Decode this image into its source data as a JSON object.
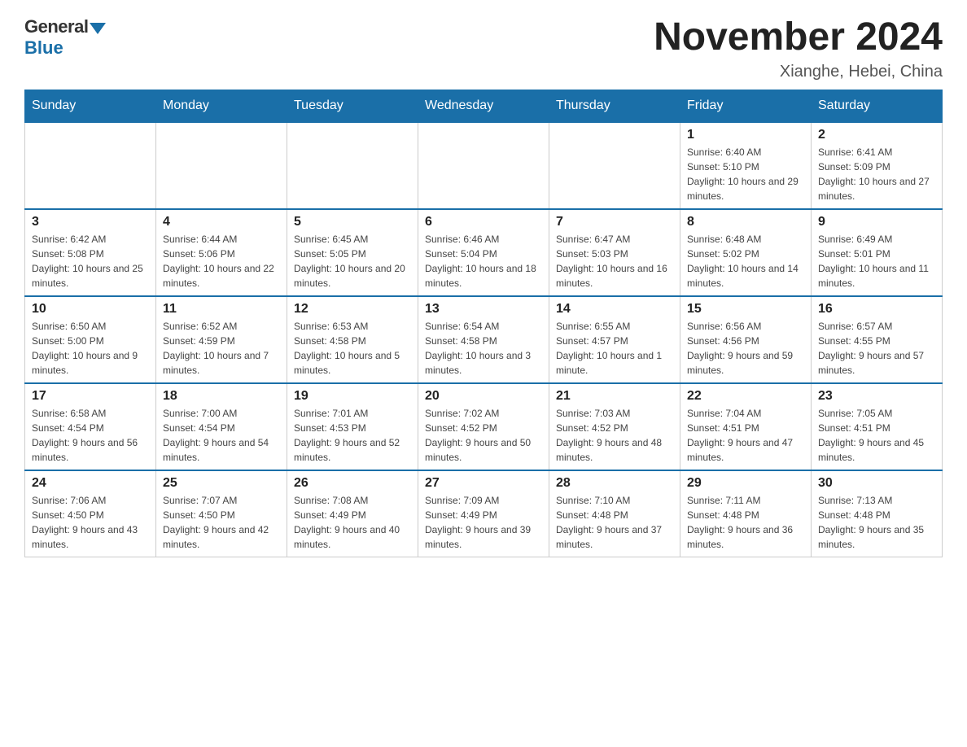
{
  "header": {
    "logo_general": "General",
    "logo_blue": "Blue",
    "month_title": "November 2024",
    "location": "Xianghe, Hebei, China"
  },
  "weekdays": [
    "Sunday",
    "Monday",
    "Tuesday",
    "Wednesday",
    "Thursday",
    "Friday",
    "Saturday"
  ],
  "weeks": [
    [
      {
        "day": "",
        "info": ""
      },
      {
        "day": "",
        "info": ""
      },
      {
        "day": "",
        "info": ""
      },
      {
        "day": "",
        "info": ""
      },
      {
        "day": "",
        "info": ""
      },
      {
        "day": "1",
        "info": "Sunrise: 6:40 AM\nSunset: 5:10 PM\nDaylight: 10 hours and 29 minutes."
      },
      {
        "day": "2",
        "info": "Sunrise: 6:41 AM\nSunset: 5:09 PM\nDaylight: 10 hours and 27 minutes."
      }
    ],
    [
      {
        "day": "3",
        "info": "Sunrise: 6:42 AM\nSunset: 5:08 PM\nDaylight: 10 hours and 25 minutes."
      },
      {
        "day": "4",
        "info": "Sunrise: 6:44 AM\nSunset: 5:06 PM\nDaylight: 10 hours and 22 minutes."
      },
      {
        "day": "5",
        "info": "Sunrise: 6:45 AM\nSunset: 5:05 PM\nDaylight: 10 hours and 20 minutes."
      },
      {
        "day": "6",
        "info": "Sunrise: 6:46 AM\nSunset: 5:04 PM\nDaylight: 10 hours and 18 minutes."
      },
      {
        "day": "7",
        "info": "Sunrise: 6:47 AM\nSunset: 5:03 PM\nDaylight: 10 hours and 16 minutes."
      },
      {
        "day": "8",
        "info": "Sunrise: 6:48 AM\nSunset: 5:02 PM\nDaylight: 10 hours and 14 minutes."
      },
      {
        "day": "9",
        "info": "Sunrise: 6:49 AM\nSunset: 5:01 PM\nDaylight: 10 hours and 11 minutes."
      }
    ],
    [
      {
        "day": "10",
        "info": "Sunrise: 6:50 AM\nSunset: 5:00 PM\nDaylight: 10 hours and 9 minutes."
      },
      {
        "day": "11",
        "info": "Sunrise: 6:52 AM\nSunset: 4:59 PM\nDaylight: 10 hours and 7 minutes."
      },
      {
        "day": "12",
        "info": "Sunrise: 6:53 AM\nSunset: 4:58 PM\nDaylight: 10 hours and 5 minutes."
      },
      {
        "day": "13",
        "info": "Sunrise: 6:54 AM\nSunset: 4:58 PM\nDaylight: 10 hours and 3 minutes."
      },
      {
        "day": "14",
        "info": "Sunrise: 6:55 AM\nSunset: 4:57 PM\nDaylight: 10 hours and 1 minute."
      },
      {
        "day": "15",
        "info": "Sunrise: 6:56 AM\nSunset: 4:56 PM\nDaylight: 9 hours and 59 minutes."
      },
      {
        "day": "16",
        "info": "Sunrise: 6:57 AM\nSunset: 4:55 PM\nDaylight: 9 hours and 57 minutes."
      }
    ],
    [
      {
        "day": "17",
        "info": "Sunrise: 6:58 AM\nSunset: 4:54 PM\nDaylight: 9 hours and 56 minutes."
      },
      {
        "day": "18",
        "info": "Sunrise: 7:00 AM\nSunset: 4:54 PM\nDaylight: 9 hours and 54 minutes."
      },
      {
        "day": "19",
        "info": "Sunrise: 7:01 AM\nSunset: 4:53 PM\nDaylight: 9 hours and 52 minutes."
      },
      {
        "day": "20",
        "info": "Sunrise: 7:02 AM\nSunset: 4:52 PM\nDaylight: 9 hours and 50 minutes."
      },
      {
        "day": "21",
        "info": "Sunrise: 7:03 AM\nSunset: 4:52 PM\nDaylight: 9 hours and 48 minutes."
      },
      {
        "day": "22",
        "info": "Sunrise: 7:04 AM\nSunset: 4:51 PM\nDaylight: 9 hours and 47 minutes."
      },
      {
        "day": "23",
        "info": "Sunrise: 7:05 AM\nSunset: 4:51 PM\nDaylight: 9 hours and 45 minutes."
      }
    ],
    [
      {
        "day": "24",
        "info": "Sunrise: 7:06 AM\nSunset: 4:50 PM\nDaylight: 9 hours and 43 minutes."
      },
      {
        "day": "25",
        "info": "Sunrise: 7:07 AM\nSunset: 4:50 PM\nDaylight: 9 hours and 42 minutes."
      },
      {
        "day": "26",
        "info": "Sunrise: 7:08 AM\nSunset: 4:49 PM\nDaylight: 9 hours and 40 minutes."
      },
      {
        "day": "27",
        "info": "Sunrise: 7:09 AM\nSunset: 4:49 PM\nDaylight: 9 hours and 39 minutes."
      },
      {
        "day": "28",
        "info": "Sunrise: 7:10 AM\nSunset: 4:48 PM\nDaylight: 9 hours and 37 minutes."
      },
      {
        "day": "29",
        "info": "Sunrise: 7:11 AM\nSunset: 4:48 PM\nDaylight: 9 hours and 36 minutes."
      },
      {
        "day": "30",
        "info": "Sunrise: 7:13 AM\nSunset: 4:48 PM\nDaylight: 9 hours and 35 minutes."
      }
    ]
  ]
}
